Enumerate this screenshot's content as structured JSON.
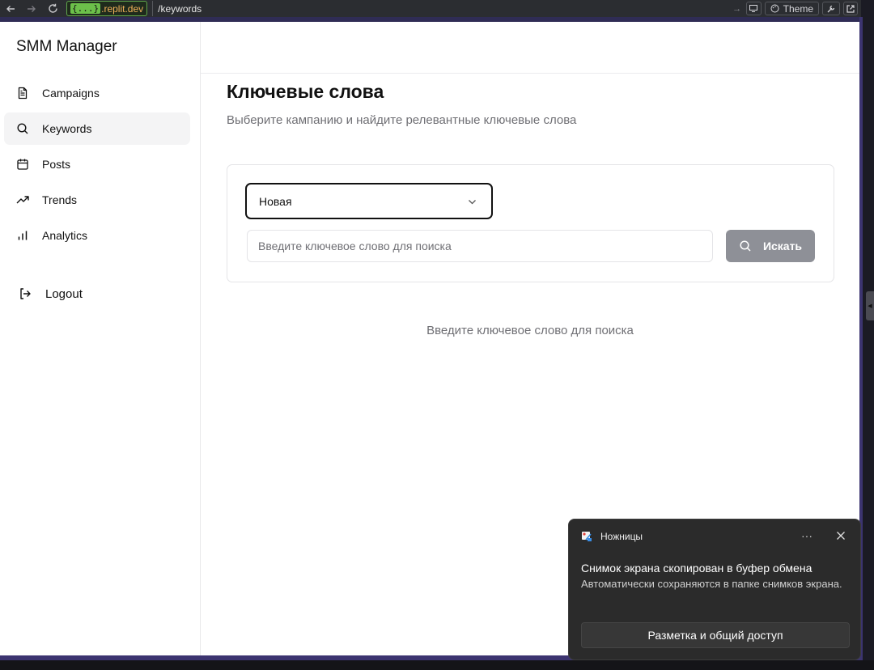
{
  "browser": {
    "url_braces": "{...}",
    "url_host": ".replit.dev",
    "url_path": "/keywords",
    "theme_label": "Theme"
  },
  "sidebar": {
    "brand": "SMM Manager",
    "items": [
      {
        "label": "Campaigns",
        "icon": "file-text-icon"
      },
      {
        "label": "Keywords",
        "icon": "search-icon",
        "active": true
      },
      {
        "label": "Posts",
        "icon": "calendar-icon"
      },
      {
        "label": "Trends",
        "icon": "trending-up-icon"
      },
      {
        "label": "Analytics",
        "icon": "bar-chart-icon"
      }
    ],
    "logout_label": "Logout"
  },
  "main": {
    "title": "Ключевые слова",
    "subtitle": "Выберите кампанию и найдите релевантные ключевые слова",
    "campaign_select": {
      "value": "Новая"
    },
    "search": {
      "placeholder": "Введите ключевое слово для поиска",
      "value": ""
    },
    "search_button": "Искать",
    "empty_state": "Введите ключевое слово для поиска"
  },
  "toast": {
    "app_name": "Ножницы",
    "more": "···",
    "title": "Снимок экрана скопирован в буфер обмена",
    "body": "Автоматически сохраняются в папке снимков экрана.",
    "action": "Разметка и общий доступ"
  },
  "colors": {
    "accent_url": "#6cc04a",
    "search_button_bg": "#8e9097",
    "active_nav_bg": "#f4f4f5",
    "frame": "#3c3470"
  }
}
